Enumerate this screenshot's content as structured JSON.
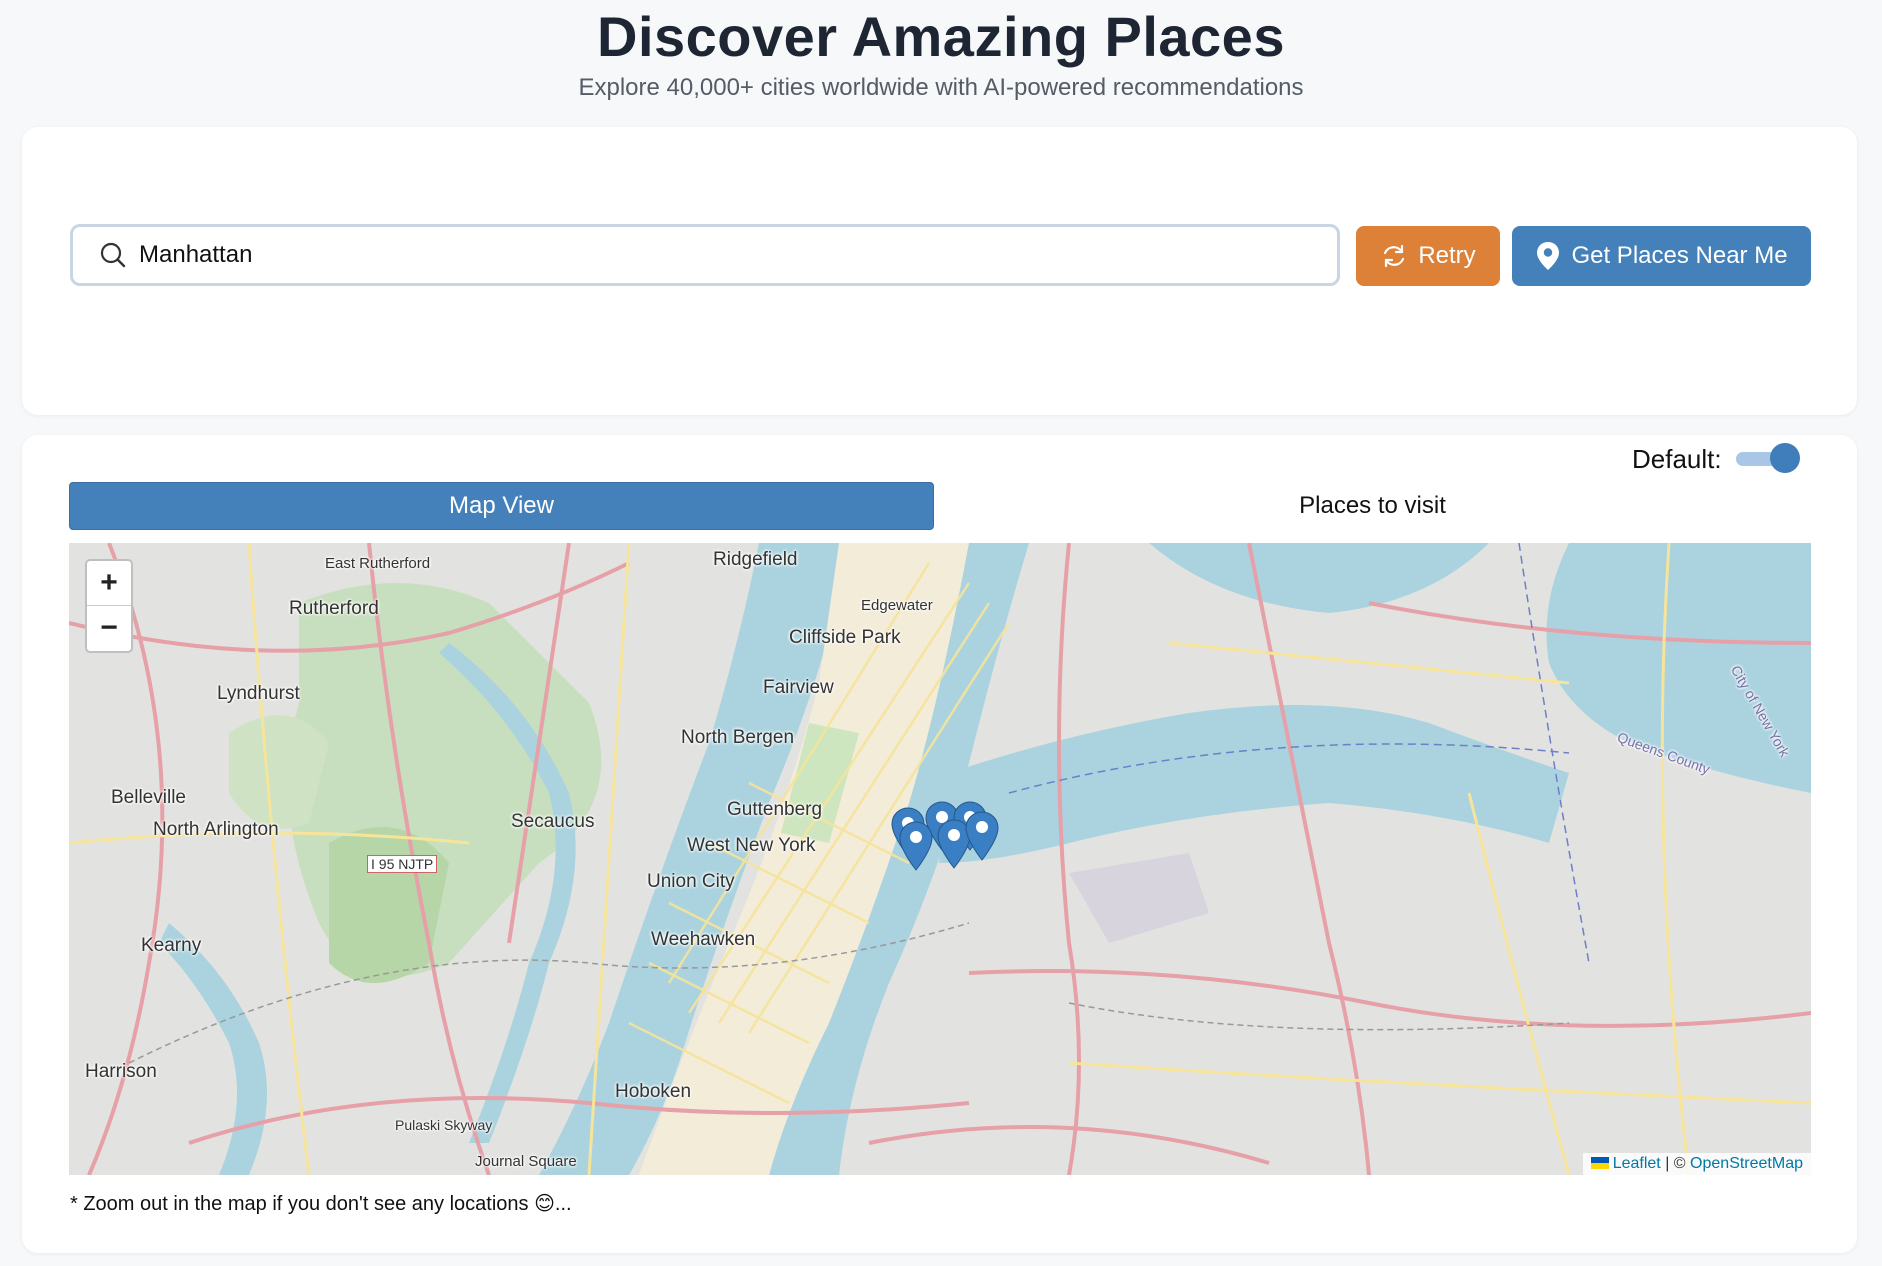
{
  "header": {
    "title": "Discover Amazing Places",
    "subtitle": "Explore 40,000+ cities worldwide with AI-powered recommendations"
  },
  "search": {
    "value": "Manhattan",
    "icon": "search-icon"
  },
  "buttons": {
    "retry_label": "Retry",
    "retry_icon": "refresh-icon",
    "near_label": "Get Places Near Me",
    "near_icon": "map-pin-icon"
  },
  "toggle": {
    "label": "Default:",
    "on": true
  },
  "tabs": {
    "map_label": "Map View",
    "places_label": "Places to visit",
    "active": "Map View"
  },
  "map": {
    "zoom_in": "+",
    "zoom_out": "−",
    "attribution_leaflet": "Leaflet",
    "attribution_sep": "| ©",
    "attribution_osm": "OpenStreetMap",
    "labels": [
      "Ridgefield",
      "Edgewater",
      "Cliffside Park",
      "Fairview",
      "North Bergen",
      "Guttenberg",
      "West New York",
      "Union City",
      "Weehawken",
      "Hoboken",
      "Secaucus",
      "Rutherford",
      "East Rutherford",
      "Lyndhurst",
      "Belleville",
      "North Arlington",
      "Kearny",
      "Harrison",
      "Pulaski Skyway",
      "Journal Square",
      "I 95 NJTP",
      "Queens County",
      "City of New York"
    ],
    "marker_count": 6
  },
  "note": "* Zoom out in the map if you don't see any locations 😊...",
  "colors": {
    "primary": "#4480b9",
    "retry": "#dd8038",
    "background": "#f6f8fa"
  }
}
